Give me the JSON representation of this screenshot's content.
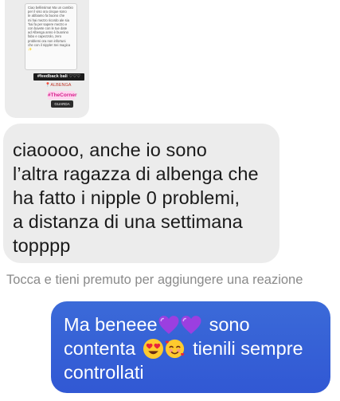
{
  "shared_story": {
    "card_text": "Ciao bellissima! Ma un cambio\nper il viso ora cinque sono\nte abbiamo fa buono che\nmi hai mezzo ricordo ale sia\n'hai fa per sapere mezzo e\ncon bavete con le tue date\nad Albenga anno è buonino\nfabo e capezzolo, zero\nproblemi ora non infortuni\nche con il nipple! Sei magica\n✨",
    "tag": "#feedback bali ♡♡♡",
    "location": "📍ALBENGA",
    "sticker": "#TheCorner",
    "badge": "GUARDA"
  },
  "incoming_message": {
    "text": "ciaoooo, anche io sono\nl’altra ragazza di albenga che\nha fatto i nipple 0 problemi,\na distanza di una settimana\ntopppp"
  },
  "reaction_hint": "Tocca e tieni premuto per aggiungere una reazione",
  "outgoing_message": {
    "line1_start": "Ma beneee",
    "line1_end": "sono",
    "line2_start": "contenta",
    "line2_end": "tienili sempre",
    "line3": "controllati",
    "heart_color": "#9b3fe0",
    "bubble_color": "#3560d6"
  }
}
